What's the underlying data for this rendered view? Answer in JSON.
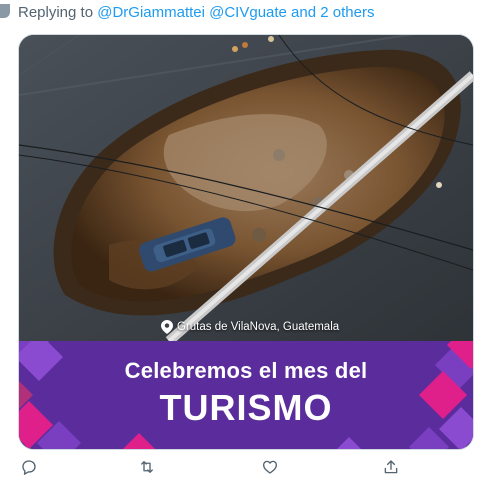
{
  "reply": {
    "prefix": "Replying to ",
    "mentions": "@DrGiammattei @CIVguate and 2 others"
  },
  "media": {
    "location_label": "Grutas de VilaNova, Guatemala",
    "banner_line1": "Celebremos el mes del",
    "banner_line2": "TURISMO"
  },
  "actions": {
    "icons": [
      "reply-icon",
      "retweet-icon",
      "like-icon",
      "share-icon"
    ]
  },
  "colors": {
    "link": "#1d9bf0",
    "muted": "#536471",
    "banner_purple": "#5b2d9c",
    "banner_magenta": "#e0208a"
  }
}
